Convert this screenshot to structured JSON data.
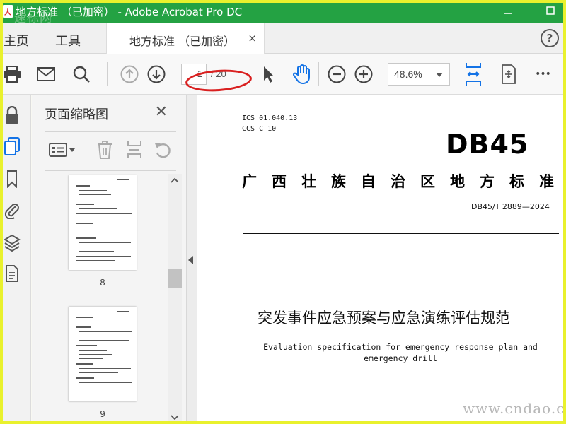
{
  "window": {
    "title": "地方标准 （已加密） - Adobe Acrobat Pro DC",
    "watermark": "速标网",
    "app_icon_glyph": "人"
  },
  "tabs": {
    "home": "主页",
    "tools": "工具",
    "document": "地方标准 （已加密）",
    "close_glyph": "×",
    "help_glyph": "?"
  },
  "toolbar": {
    "current_page": "1",
    "total_pages": "/ 20",
    "zoom": "48.6%",
    "more_glyph": "•••"
  },
  "thumbnail_panel": {
    "title": "页面缩略图",
    "close_glyph": "✕",
    "thumbnails": [
      {
        "label": "8"
      },
      {
        "label": "9"
      }
    ]
  },
  "document": {
    "ics_line": "ICS  01.040.13",
    "ccs_line": "CCS  C  10",
    "db_code": "DB45",
    "standard_name": "广西壮族自治区地方标准",
    "standard_number": "DB45/T 2889—2024",
    "title_cn": "突发事件应急预案与应急演练评估规范",
    "title_en": "Evaluation specification for emergency response plan and emergency drill",
    "watermark": "www.cndao.com"
  },
  "colors": {
    "titlebar": "#24a243",
    "frame": "#e9f12d",
    "annotation": "#d92020",
    "accent_blue": "#1473e6"
  }
}
